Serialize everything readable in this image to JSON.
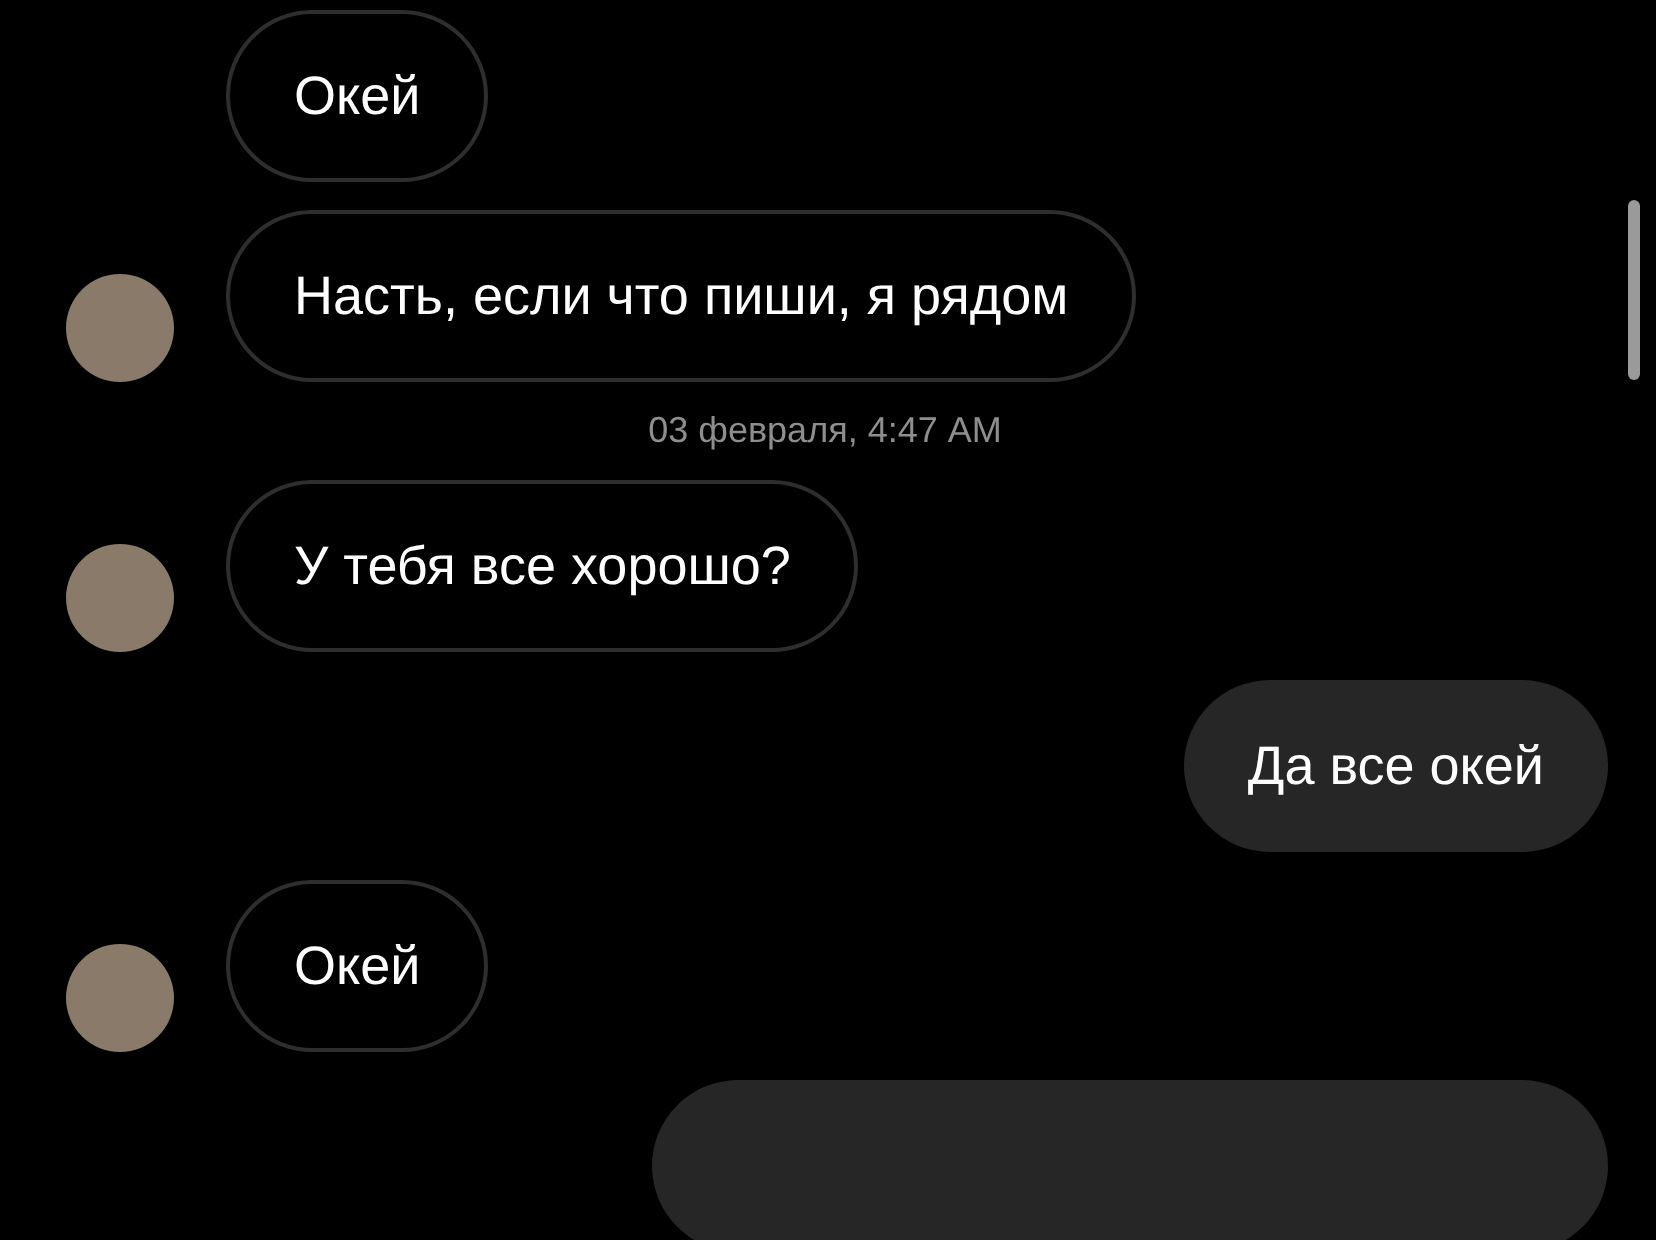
{
  "messages": [
    {
      "kind": "incoming",
      "text": "Окей",
      "show_avatar": false
    },
    {
      "kind": "incoming",
      "text": "Насть, если что пиши, я рядом",
      "show_avatar": true
    },
    {
      "kind": "timestamp",
      "text": "03 февраля, 4:47 AM"
    },
    {
      "kind": "incoming",
      "text": "У тебя все хорошо?",
      "show_avatar": true
    },
    {
      "kind": "outgoing",
      "text": "Да все окей"
    },
    {
      "kind": "incoming",
      "text": "Окей",
      "show_avatar": true
    },
    {
      "kind": "outgoing-cut"
    }
  ]
}
